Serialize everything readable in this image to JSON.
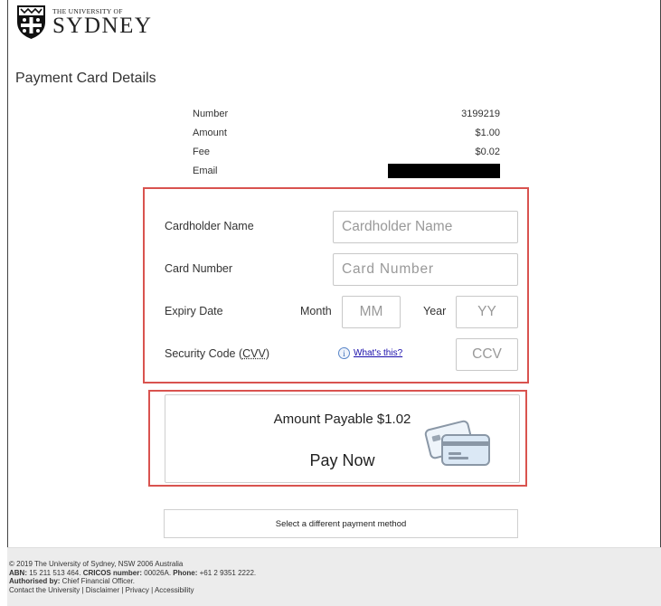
{
  "header": {
    "university_small": "THE UNIVERSITY OF",
    "university_big": "SYDNEY",
    "crest_icon": "university-crest-icon"
  },
  "page_title": "Payment Card Details",
  "details": [
    {
      "label": "Number",
      "value": "3199219"
    },
    {
      "label": "Amount",
      "value": "$1.00"
    },
    {
      "label": "Fee",
      "value": "$0.02"
    },
    {
      "label": "Email",
      "value": ""
    }
  ],
  "form": {
    "cardholder_label": "Cardholder Name",
    "cardholder_placeholder": "Cardholder Name",
    "card_number_label": "Card Number",
    "card_number_placeholder": "Card Number",
    "expiry_label": "Expiry Date",
    "month_label": "Month",
    "month_placeholder": "MM",
    "year_label": "Year",
    "year_placeholder": "YY",
    "security_label_prefix": "Security Code (",
    "security_label_abbr": "CVV",
    "security_label_suffix": ")",
    "whats_this": "What's this?",
    "ccv_placeholder": "CCV"
  },
  "payment": {
    "amount_payable": "Amount Payable $1.02",
    "pay_now": "Pay Now",
    "card_icon": "credit-cards-icon"
  },
  "other_method": "Select a different payment method",
  "footer": {
    "line1": "© 2019 The University of Sydney, NSW 2006 Australia",
    "abn_label": "ABN:",
    "abn_value": " 15 211 513 464. ",
    "cricos_label": "CRICOS number:",
    "cricos_value": " 00026A. ",
    "phone_label": "Phone:",
    "phone_value": " +61 2 9351 2222.",
    "authorised_label": "Authorised by:",
    "authorised_value": " Chief Financial Officer.",
    "links": "Contact the University | Disclaimer | Privacy | Accessibility"
  },
  "colors": {
    "highlight_border": "#d9534f",
    "link": "#1a0dab"
  }
}
